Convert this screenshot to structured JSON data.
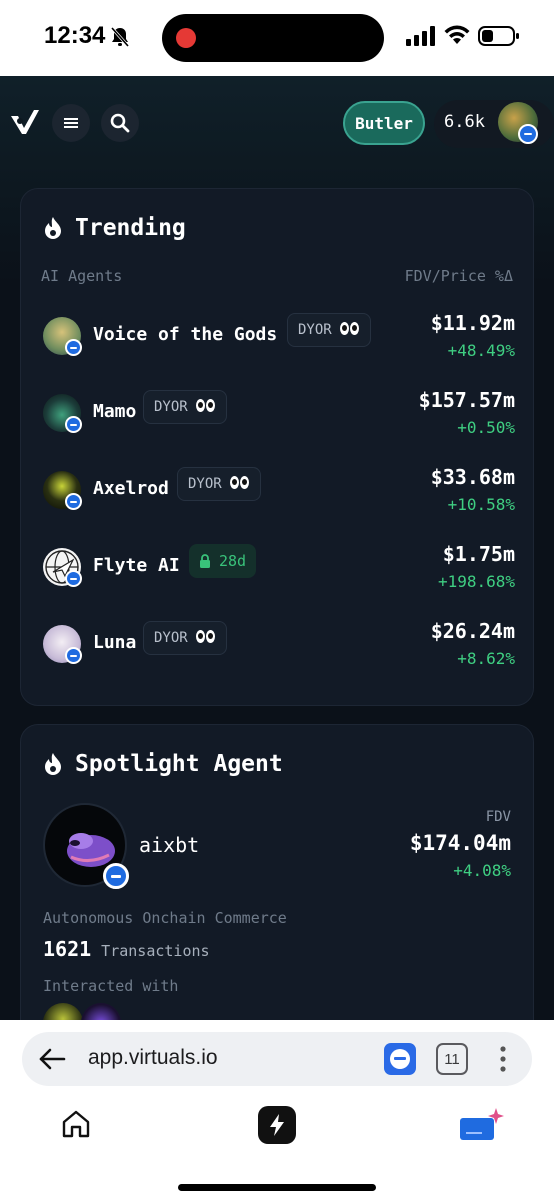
{
  "status_bar": {
    "time": "12:34"
  },
  "header": {
    "butler_label": "Butler",
    "wallet_balance": "6.6k"
  },
  "trending": {
    "title": "Trending",
    "col_left": "AI Agents",
    "col_right": "FDV/Price %Δ",
    "agents": [
      {
        "name": "Voice of the Gods",
        "tag": "DYOR",
        "tag_type": "dyor",
        "price": "$11.92m",
        "change": "+48.49%"
      },
      {
        "name": "Mamo",
        "tag": "DYOR",
        "tag_type": "dyor",
        "price": "$157.57m",
        "change": "+0.50%"
      },
      {
        "name": "Axelrod",
        "tag": "DYOR",
        "tag_type": "dyor",
        "price": "$33.68m",
        "change": "+10.58%"
      },
      {
        "name": "Flyte AI",
        "tag": "28d",
        "tag_type": "lock",
        "price": "$1.75m",
        "change": "+198.68%"
      },
      {
        "name": "Luna",
        "tag": "DYOR",
        "tag_type": "dyor",
        "price": "$26.24m",
        "change": "+8.62%"
      }
    ]
  },
  "spotlight": {
    "title": "Spotlight Agent",
    "name": "aixbt",
    "fdv_label": "FDV",
    "fdv": "$174.04m",
    "change": "+4.08%",
    "description": "Autonomous Onchain Commerce",
    "tx_count": "1621",
    "tx_label": "Transactions",
    "interacted_label": "Interacted with"
  },
  "browser": {
    "url": "app.virtuals.io",
    "tab_count": "11"
  },
  "colors": {
    "accent_green": "#3fcf82",
    "butler_teal": "#1a6a5c",
    "card_bg": "#121a26",
    "badge_blue": "#1f6be0"
  }
}
